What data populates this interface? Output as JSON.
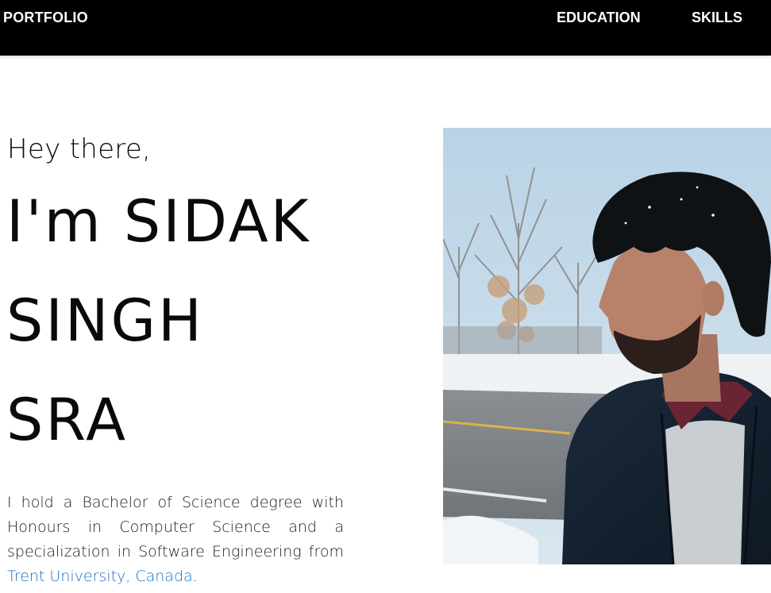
{
  "nav": {
    "brand": "PORTFOLIO",
    "links": [
      "EDUCATION",
      "SKILLS"
    ],
    "background": "#000000"
  },
  "hero": {
    "greeting": "Hey there,",
    "name_lines": [
      "I'm SIDAK",
      "SINGH",
      "SRA"
    ],
    "bio_prefix": "I hold a Bachelor of Science degree with Honours in Computer Science and a specialization in Software Engineering from ",
    "bio_link": "Trent University, Canada",
    "bio_suffix": ".",
    "link_color": "#1e6fc4",
    "photo_alt": "portrait-photo"
  }
}
